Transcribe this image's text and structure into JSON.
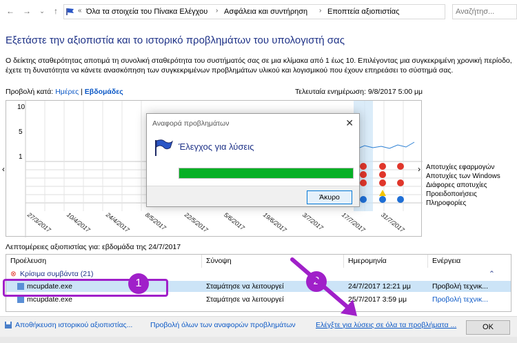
{
  "address": {
    "path": [
      "Όλα τα στοιχεία του Πίνακα Ελέγχου",
      "Ασφάλεια και συντήρηση",
      "Εποπτεία αξιοπιστίας"
    ],
    "search_placeholder": "Αναζήτησ..."
  },
  "heading": "Εξετάστε την αξιοπιστία και το ιστορικό προβλημάτων του υπολογιστή σας",
  "description": "Ο δείκτης σταθερότητας αποτιμά τη συνολική σταθερότητα του συστήματός σας σε μια κλίμακα από 1 έως 10. Επιλέγοντας μια συγκεκριμένη χρονική περίοδο, έχετε τη δυνατότητα να κάνετε ανασκόπηση των συγκεκριμένων προβλημάτων υλικού και λογισμικού που έχουν επηρεάσει το σύστημά σας.",
  "view_by": {
    "label": "Προβολή κατά:",
    "days": "Ημέρες",
    "sep": "|",
    "weeks": "Εβδομάδες"
  },
  "last_update": "Τελευταία ενημέρωση: 9/8/2017 5:00 μμ",
  "chart": {
    "y_ticks": [
      "10",
      "5",
      "1"
    ],
    "categories": [
      "Αποτυχίες εφαρμογών",
      "Αποτυχίες των Windows",
      "Διάφορες αποτυχίες",
      "Προειδοποιήσεις",
      "Πληροφορίες"
    ],
    "dates": [
      "27/3/2017",
      "10/4/2017",
      "24/4/2017",
      "8/5/2017",
      "22/5/2017",
      "5/6/2017",
      "19/6/2017",
      "3/7/2017",
      "17/7/2017",
      "31/7/2017"
    ],
    "nav_left": "‹",
    "nav_right": "›"
  },
  "dialog": {
    "title": "Αναφορά προβλημάτων",
    "close": "✕",
    "message": "Έλεγχος για λύσεις",
    "progress": 1.0,
    "cancel": "Άκυρο"
  },
  "details_label": "Λεπτομέρειες αξιοπιστίας για: εβδομάδα της 24/7/2017",
  "table": {
    "headers": [
      "Προέλευση",
      "Σύνοψη",
      "Ημερομηνία",
      "Ενέργεια"
    ],
    "group": "Κρίσιμα συμβάντα (21)",
    "rows": [
      {
        "source": "mcupdate.exe",
        "summary": "Σταμάτησε να λειτουργεί",
        "date": "24/7/2017 12:21 μμ",
        "action": "Προβολή τεχνικ..."
      },
      {
        "source": "mcupdate.exe",
        "summary": "Σταμάτησε να λειτουργεί",
        "date": "25/7/2017 3:59 μμ",
        "action": "Προβολή τεχνικ..."
      }
    ]
  },
  "bottom": {
    "save": "Αποθήκευση ιστορικού αξιοπιστίας...",
    "view_all": "Προβολή όλων των αναφορών προβλημάτων",
    "check": "Ελέγξτε για λύσεις σε όλα τα προβλήματα ...",
    "ok": "OK"
  },
  "badges": [
    "1",
    "2"
  ],
  "colors": {
    "accent": "#a020c9",
    "link": "#0b58c6",
    "heading": "#1e3287",
    "progress": "#06b025",
    "error": "#e0362b"
  }
}
